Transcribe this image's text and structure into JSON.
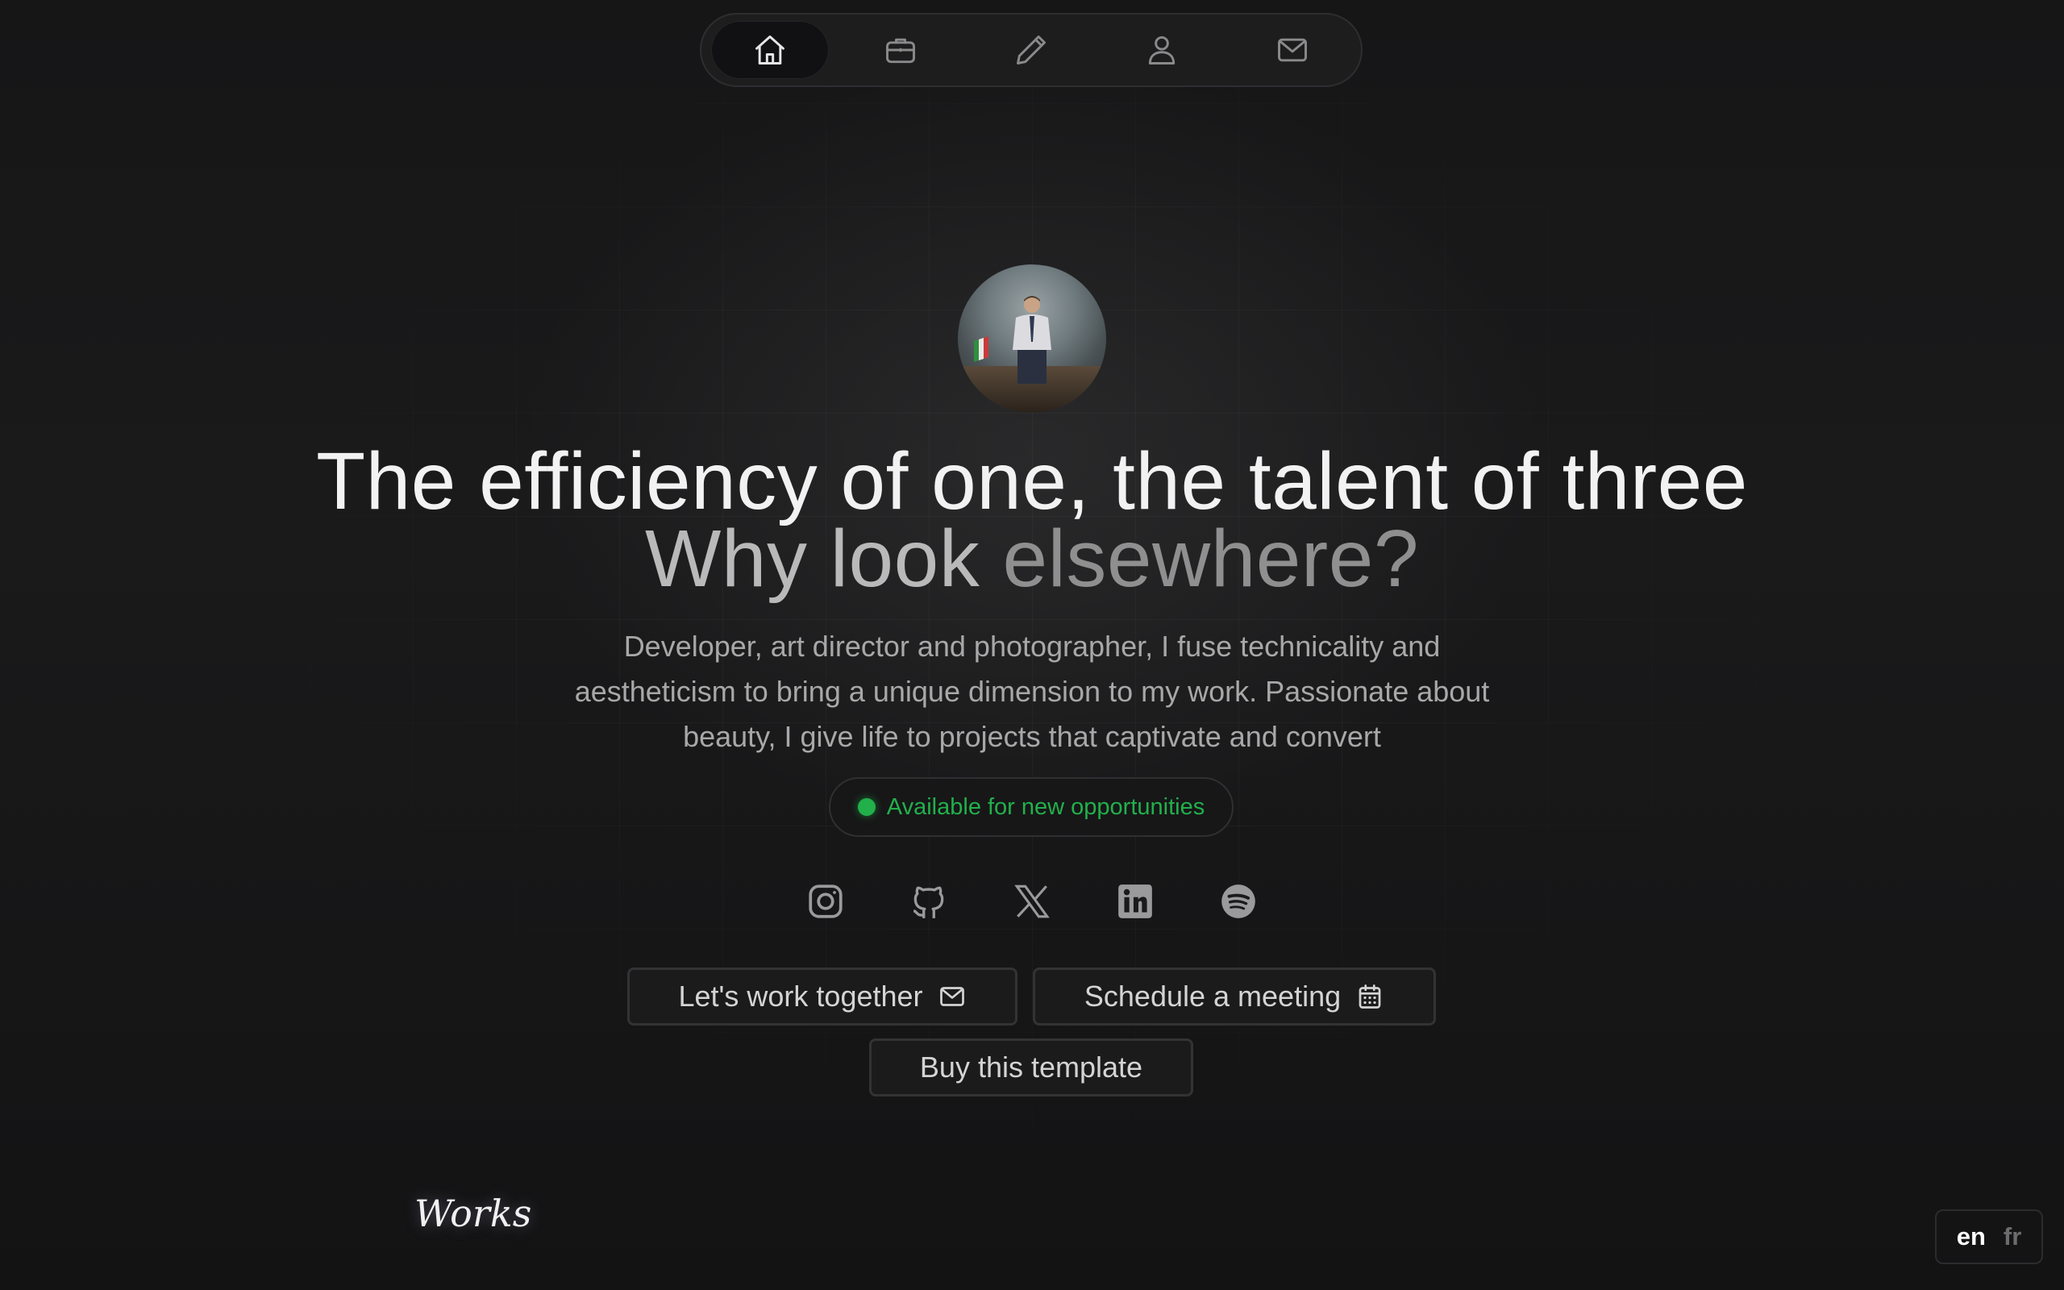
{
  "nav": {
    "items": [
      {
        "icon": "home-icon",
        "active": true
      },
      {
        "icon": "briefcase-icon",
        "active": false
      },
      {
        "icon": "pencil-icon",
        "active": false
      },
      {
        "icon": "user-icon",
        "active": false
      },
      {
        "icon": "mail-icon",
        "active": false
      }
    ]
  },
  "hero": {
    "headline": "The efficiency of one, the talent of three",
    "subheadline_part1": "Why look ",
    "subheadline_part2": "elsewhere?",
    "description": "Developer, art director and photographer, I fuse technicality and aestheticism to bring a unique dimension to my work. Passionate about beauty, I give life to projects that captivate and convert",
    "status": "Available for new opportunities",
    "status_color": "#22b04b"
  },
  "socials": [
    {
      "icon": "instagram-icon"
    },
    {
      "icon": "github-icon"
    },
    {
      "icon": "x-twitter-icon"
    },
    {
      "icon": "linkedin-icon"
    },
    {
      "icon": "spotify-icon"
    }
  ],
  "buttons": {
    "work": "Let's work together",
    "meeting": "Schedule a meeting",
    "buy": "Buy this template"
  },
  "section": {
    "works_label": "Works"
  },
  "lang": {
    "en": "en",
    "fr": "fr"
  }
}
